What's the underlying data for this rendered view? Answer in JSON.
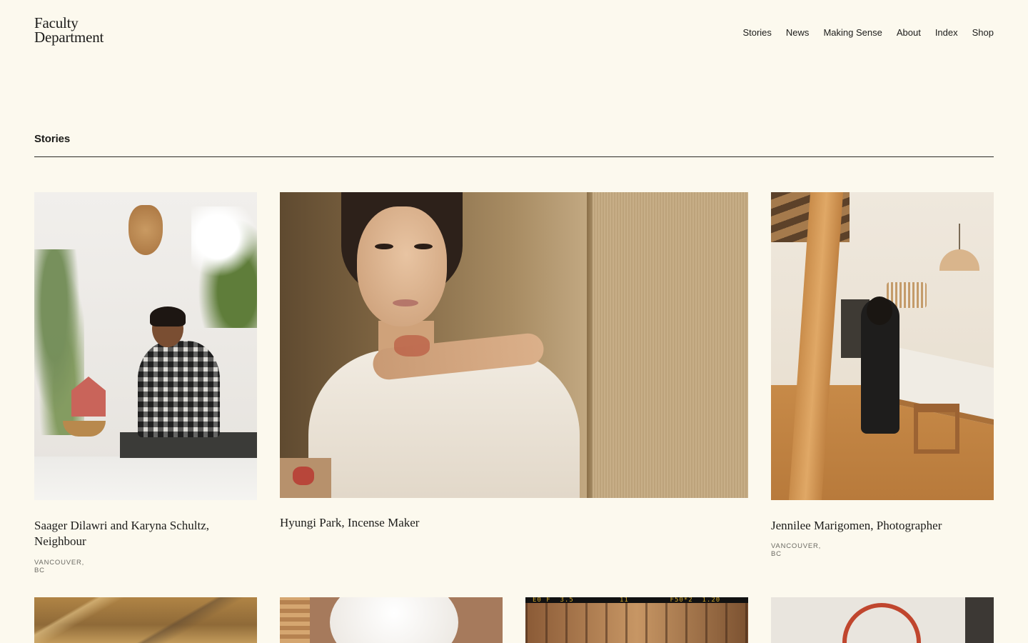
{
  "brand": {
    "line1": "Faculty",
    "line2": "Department"
  },
  "nav": {
    "items": [
      "Stories",
      "News",
      "Making Sense",
      "About",
      "Index",
      "Shop"
    ]
  },
  "section": {
    "title": "Stories"
  },
  "stories": [
    {
      "title": "Saager Dilawri and Karyna Schultz, Neighbour",
      "location": "VANCOUVER, BC"
    },
    {
      "title": "Hyungi Park, Incense Maker",
      "location": ""
    },
    {
      "title": "Jennilee Marigomen, Photographer",
      "location": "VANCOUVER, BC"
    }
  ],
  "film_strip": {
    "text": "E0 F  3.5          11         F50*2  1.20"
  },
  "colors": {
    "background": "#fcf9ee",
    "text": "#1c1c1a",
    "muted": "#6b6a63"
  }
}
